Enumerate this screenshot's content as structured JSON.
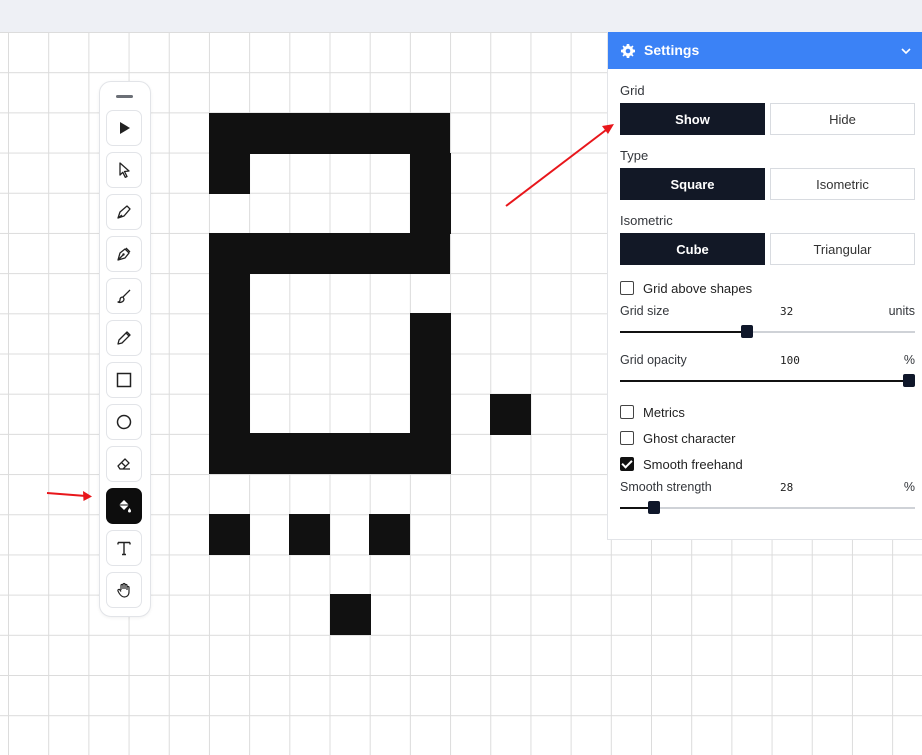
{
  "settings": {
    "title": "Settings",
    "grid": {
      "label": "Grid",
      "options": [
        "Show",
        "Hide"
      ],
      "selected": "Show"
    },
    "type": {
      "label": "Type",
      "options": [
        "Square",
        "Isometric"
      ],
      "selected": "Square"
    },
    "isometric": {
      "label": "Isometric",
      "options": [
        "Cube",
        "Triangular"
      ],
      "selected": "Cube"
    },
    "grid_above_shapes": {
      "label": "Grid above shapes",
      "checked": false
    },
    "grid_size": {
      "label": "Grid size",
      "value": "32",
      "unit": "units",
      "fraction": 0.43
    },
    "grid_opacity": {
      "label": "Grid opacity",
      "value": "100",
      "unit": "%",
      "fraction": 1.0
    },
    "metrics": {
      "label": "Metrics",
      "checked": false
    },
    "ghost_character": {
      "label": "Ghost character",
      "checked": false
    },
    "smooth_freehand": {
      "label": "Smooth freehand",
      "checked": true
    },
    "smooth_strength": {
      "label": "Smooth strength",
      "value": "28",
      "unit": "%",
      "fraction": 0.115
    }
  },
  "toolbar": {
    "tools": [
      {
        "icon": "play-select-icon"
      },
      {
        "icon": "pointer-icon"
      },
      {
        "icon": "brush-nib-icon"
      },
      {
        "icon": "pen-icon"
      },
      {
        "icon": "paintbrush-icon"
      },
      {
        "icon": "pencil-icon"
      },
      {
        "icon": "rectangle-icon"
      },
      {
        "icon": "circle-icon"
      },
      {
        "icon": "eraser-icon"
      },
      {
        "icon": "fill-bucket-icon",
        "active": true
      },
      {
        "icon": "text-icon"
      },
      {
        "icon": "hand-icon"
      }
    ]
  },
  "colors": {
    "accent": "#3b82f6",
    "selected": "#121826",
    "pixel": "#111111",
    "annotation": "#e8161b"
  }
}
